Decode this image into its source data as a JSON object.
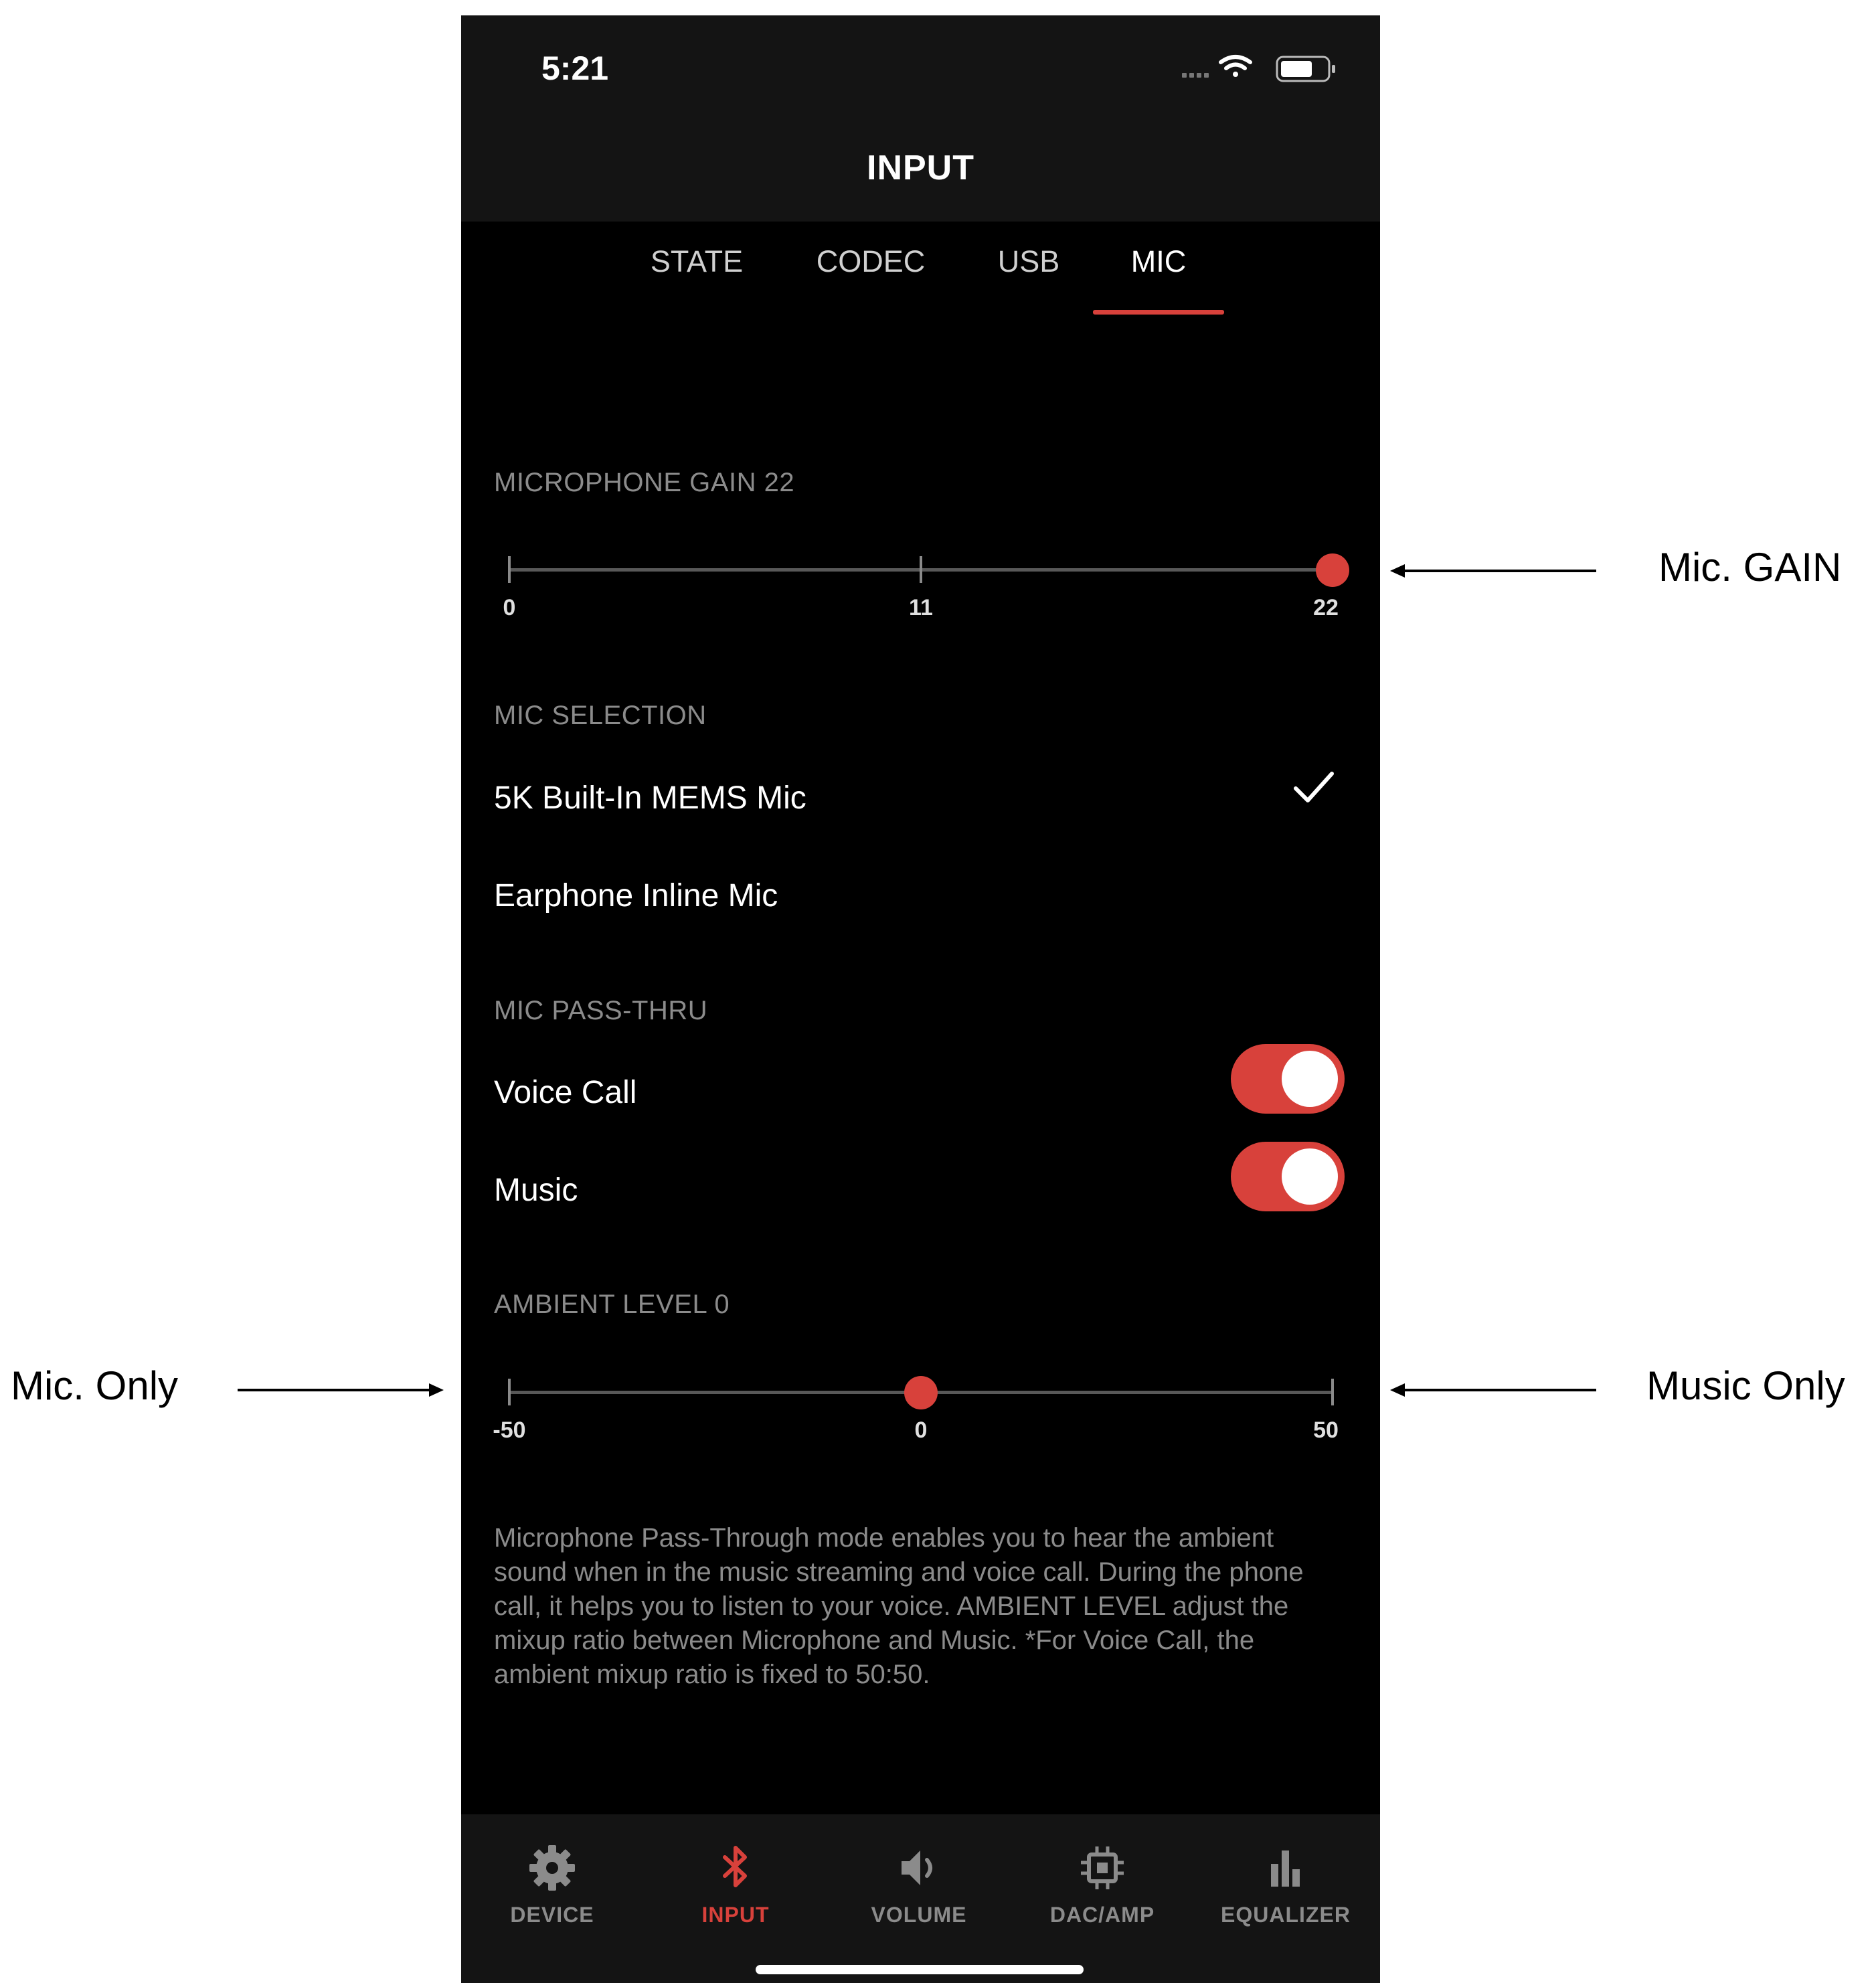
{
  "status_bar": {
    "time": "5:21"
  },
  "header": {
    "title": "INPUT"
  },
  "tabs": [
    {
      "label": "STATE",
      "active": false
    },
    {
      "label": "CODEC",
      "active": false
    },
    {
      "label": "USB",
      "active": false
    },
    {
      "label": "MIC",
      "active": true
    }
  ],
  "microphone_gain": {
    "label": "MICROPHONE GAIN 22",
    "value": 22,
    "min": 0,
    "max": 22,
    "ticks": [
      "0",
      "11",
      "22"
    ]
  },
  "mic_selection": {
    "label": "MIC SELECTION",
    "options": [
      {
        "label": "5K Built-In MEMS Mic",
        "selected": true
      },
      {
        "label": "Earphone Inline Mic",
        "selected": false
      }
    ]
  },
  "mic_pass_thru": {
    "label": "MIC PASS-THRU",
    "voice_call": {
      "label": "Voice Call",
      "on": true
    },
    "music": {
      "label": "Music",
      "on": true
    }
  },
  "ambient_level": {
    "label": "AMBIENT LEVEL 0",
    "value": 0,
    "min": -50,
    "max": 50,
    "ticks": [
      "-50",
      "0",
      "50"
    ]
  },
  "description": "Microphone Pass-Through mode enables you to hear the ambient sound when in the music streaming and voice call. During the phone call, it helps you to listen to your voice. AMBIENT LEVEL adjust the mixup ratio between Microphone and Music. *For Voice Call, the ambient mixup ratio is fixed to 50:50.",
  "bottom_nav": [
    {
      "label": "DEVICE",
      "icon": "gear-icon",
      "active": false
    },
    {
      "label": "INPUT",
      "icon": "bluetooth-icon",
      "active": true
    },
    {
      "label": "VOLUME",
      "icon": "speaker-icon",
      "active": false
    },
    {
      "label": "DAC/AMP",
      "icon": "chip-icon",
      "active": false
    },
    {
      "label": "EQUALIZER",
      "icon": "bar-chart-icon",
      "active": false
    }
  ],
  "annotations": {
    "mic_gain": "Mic. GAIN",
    "mic_only": "Mic. Only",
    "music_only": "Music Only"
  },
  "colors": {
    "accent": "#d8413b",
    "background": "#000000",
    "bar_background": "#141414",
    "muted_text": "#8b8b8b"
  }
}
